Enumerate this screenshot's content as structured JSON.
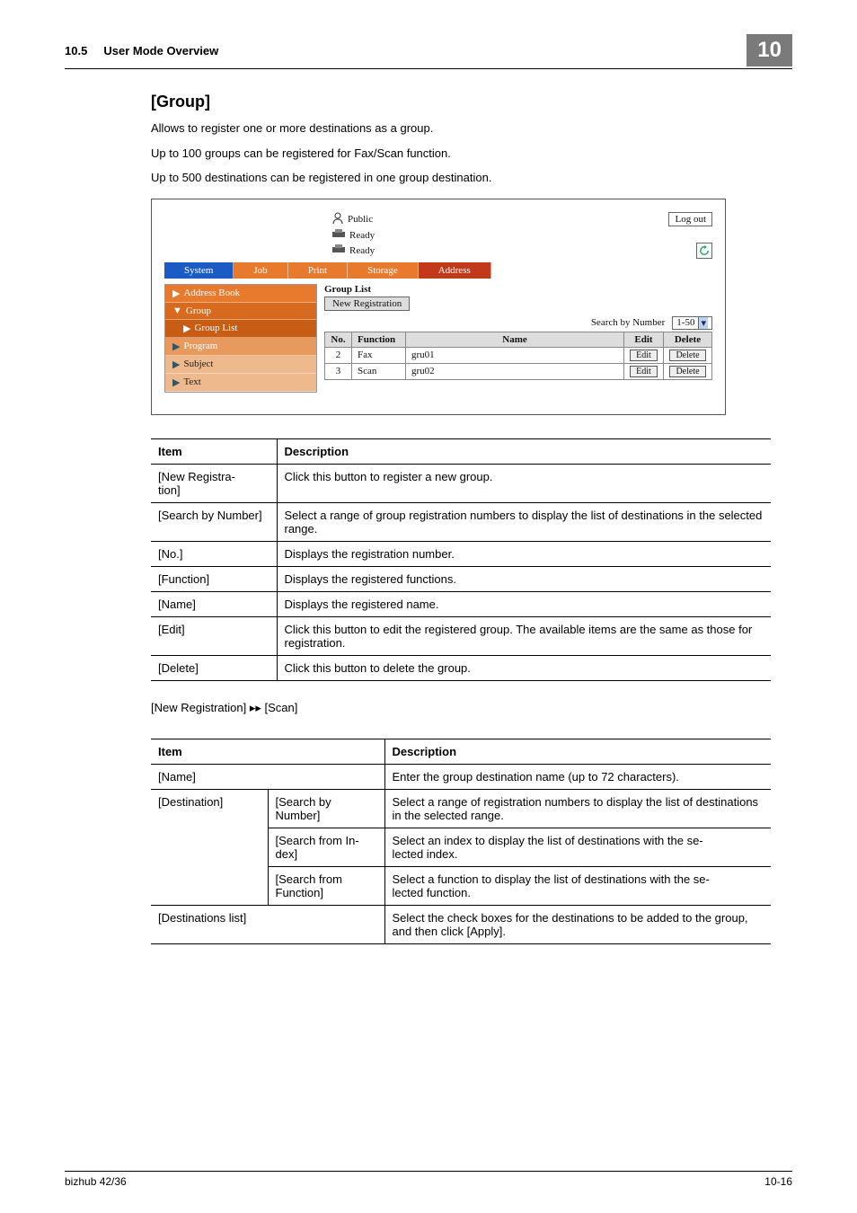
{
  "header": {
    "section_no": "10.5",
    "section_title": "User Mode Overview",
    "chapter_badge": "10"
  },
  "group": {
    "heading": "[Group]",
    "p1": "Allows to register one or more destinations as a group.",
    "p2": "Up to 100 groups can be registered for Fax/Scan function.",
    "p3": "Up to 500 destinations can be registered in one group destination."
  },
  "shot": {
    "public_label": "Public",
    "ready1": "Ready",
    "ready2": "Ready",
    "logout": "Log out",
    "tabs": {
      "system": "System",
      "job": "Job",
      "print": "Print",
      "storage": "Storage",
      "address": "Address"
    },
    "sidebar": {
      "address_book": "Address Book",
      "group": "Group",
      "group_list": "Group List",
      "program": "Program",
      "subject": "Subject",
      "text": "Text"
    },
    "pane": {
      "title": "Group List",
      "new_registration": "New Registration",
      "search_by_number": "Search by Number",
      "range": "1-50",
      "cols": {
        "no": "No.",
        "function": "Function",
        "name": "Name",
        "edit": "Edit",
        "delete": "Delete"
      },
      "rows": [
        {
          "no": "2",
          "fn": "Fax",
          "name": "gru01",
          "edit": "Edit",
          "del": "Delete"
        },
        {
          "no": "3",
          "fn": "Scan",
          "name": "gru02",
          "edit": "Edit",
          "del": "Delete"
        }
      ]
    }
  },
  "desc1": {
    "h_item": "Item",
    "h_desc": "Description",
    "rows": [
      {
        "item": "[New Registra-\ntion]",
        "desc": "Click this button to register a new group."
      },
      {
        "item": "[Search by Number]",
        "desc": "Select a range of group registration numbers to display the list of destinations in the selected range."
      },
      {
        "item": "[No.]",
        "desc": "Displays the registration number."
      },
      {
        "item": "[Function]",
        "desc": "Displays the registered functions."
      },
      {
        "item": "[Name]",
        "desc": "Displays the registered name."
      },
      {
        "item": "[Edit]",
        "desc": "Click this button to edit the registered group. The available items are the same as those for registration."
      },
      {
        "item": "[Delete]",
        "desc": "Click this button to delete the group."
      }
    ]
  },
  "subhead": "[New Registration] ▸▸ [Scan]",
  "desc2": {
    "h_item": "Item",
    "h_desc": "Description",
    "rows": {
      "name": {
        "item": "[Name]",
        "desc": "Enter the group destination name (up to 72 characters)."
      },
      "dest_label": "[Destination]",
      "dest_sub": [
        {
          "sub": "[Search by Number]",
          "desc": "Select a range of registration numbers to display the list of destinations in the selected range."
        },
        {
          "sub": "[Search from In-\ndex]",
          "desc": "Select an index to display the list of destinations with the se-\nlected index."
        },
        {
          "sub": "[Search from Function]",
          "desc": "Select a function to display the list of destinations with the se-\nlected function."
        }
      ],
      "destlist": {
        "item": "[Destinations list]",
        "desc": "Select the check boxes for the destinations to be added to the group, and then click [Apply]."
      }
    }
  },
  "footer": {
    "left": "bizhub 42/36",
    "right": "10-16"
  }
}
